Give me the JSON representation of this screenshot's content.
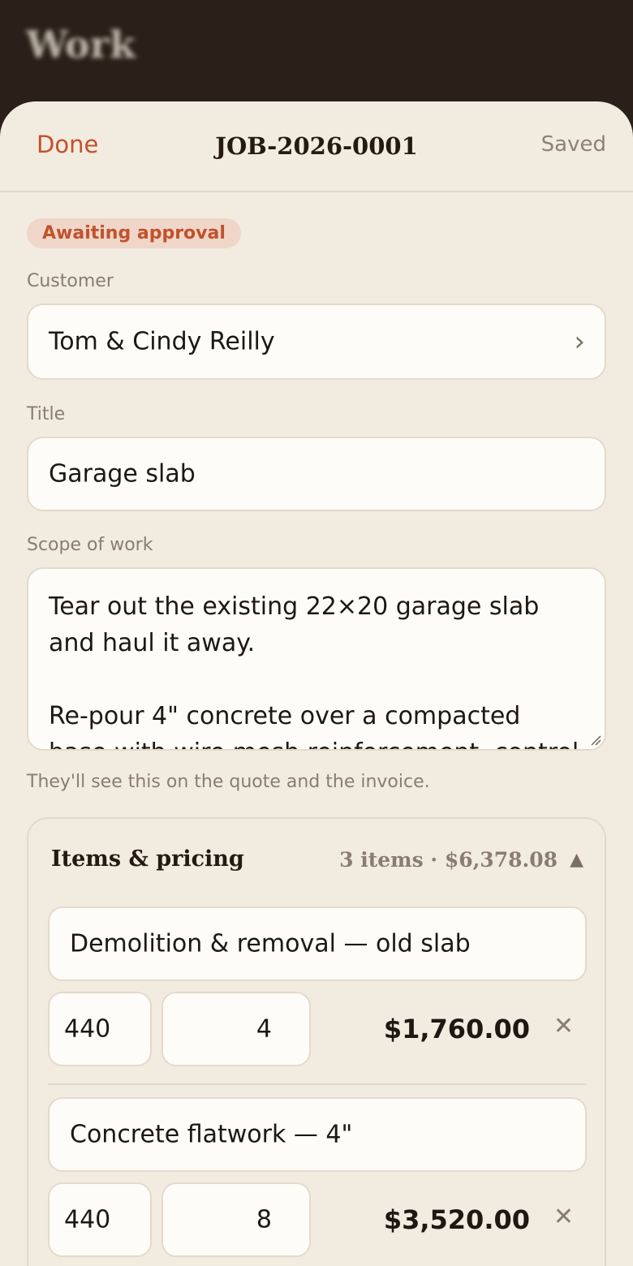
{
  "background": {
    "title": "Work"
  },
  "header": {
    "done_label": "Done",
    "job_number": "JOB-2026-0001",
    "save_status": "Saved"
  },
  "status": {
    "label": "Awaiting approval"
  },
  "customer": {
    "label": "Customer",
    "value": "Tom & Cindy Reilly"
  },
  "title_field": {
    "label": "Title",
    "value": "Garage slab"
  },
  "scope": {
    "label": "Scope of work",
    "value": "Tear out the existing 22×20 garage slab and haul it away.\n\nRe-pour 4\" concrete over a compacted base with wire mesh reinforcement, control",
    "helper": "They'll see this on the quote and the invoice."
  },
  "items": {
    "title": "Items & pricing",
    "summary": "3 items · $6,378.08",
    "collapse_glyph": "▲",
    "remove_glyph": "✕",
    "list": [
      {
        "name": "Demolition & removal — old slab",
        "qty": "440",
        "price": "4",
        "total": "$1,760.00"
      },
      {
        "name": "Concrete flatwork — 4\"",
        "qty": "440",
        "price": "8",
        "total": "$3,520.00"
      }
    ]
  },
  "colors": {
    "accent": "#c0522c",
    "sheet_bg": "#f2ebe0",
    "field_bg": "#fefcf8",
    "text": "#1e1712",
    "muted": "#8a7d70"
  }
}
